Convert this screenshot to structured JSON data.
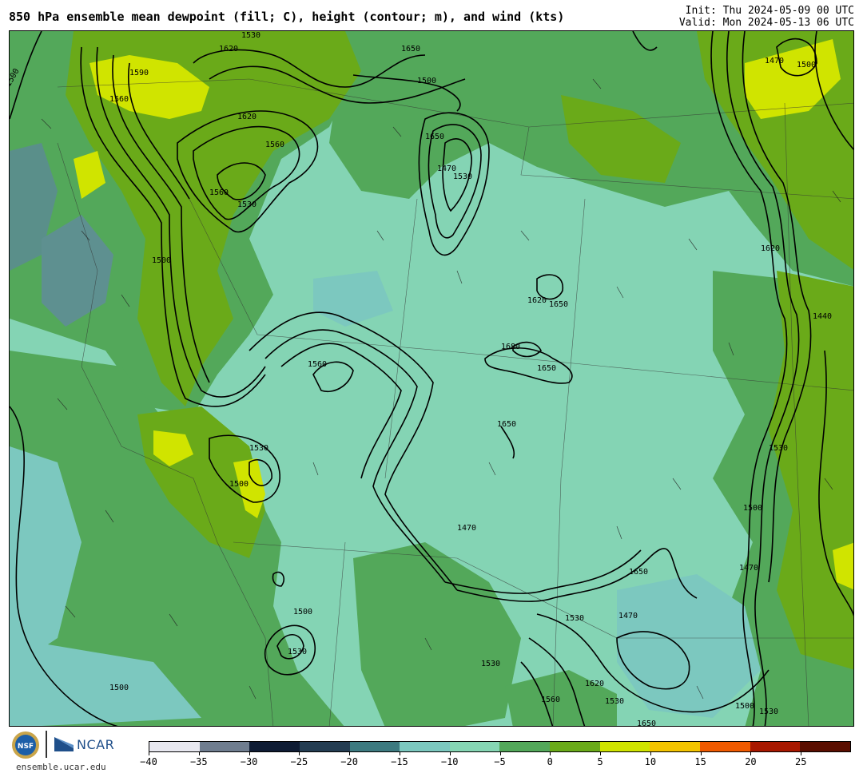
{
  "title": "850 hPa ensemble mean dewpoint (fill; C), height (contour; m), and wind (kts)",
  "init_text": "Init: Thu 2024-05-09 00 UTC",
  "valid_text": "Valid: Mon 2024-05-13 06 UTC",
  "logos": {
    "nsf_text": "NSF",
    "ncar_text": "NCAR"
  },
  "site": "ensemble.ucar.edu",
  "colorbar": {
    "colors": [
      "#e8e8f0",
      "#6f7d8f",
      "#0f1c34",
      "#243d52",
      "#3d7a80",
      "#7cc8bf",
      "#86d6b4",
      "#53a85a",
      "#6aaa19",
      "#d0e400",
      "#f4c400",
      "#f05a00",
      "#a81800",
      "#5a0e00"
    ],
    "tick_labels": [
      "−40",
      "−35",
      "−30",
      "−25",
      "−20",
      "−15",
      "−10",
      "−5",
      "0",
      "5",
      "10",
      "15",
      "20",
      "25"
    ]
  },
  "contour_labels": [
    "1500",
    "1530",
    "1560",
    "1590",
    "1620",
    "1650",
    "1470",
    "1440",
    "1680"
  ]
}
